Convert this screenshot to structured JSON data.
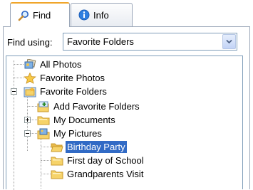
{
  "tabs": [
    {
      "label": "Find",
      "icon": "magnifier-icon",
      "active": true
    },
    {
      "label": "Info",
      "icon": "info-icon",
      "active": false
    }
  ],
  "find": {
    "label": "Find using:",
    "selected": "Favorite Folders"
  },
  "tree": {
    "items": [
      {
        "label": "All Photos",
        "icon": "photos-stack-icon"
      },
      {
        "label": "Favorite Photos",
        "icon": "star-icon"
      },
      {
        "label": "Favorite Folders",
        "icon": "favorite-folder-icon"
      },
      {
        "label": "Add Favorite Folders",
        "icon": "add-folder-icon"
      },
      {
        "label": "My Documents",
        "icon": "folder-icon"
      },
      {
        "label": "My Pictures",
        "icon": "pictures-folder-icon"
      },
      {
        "label": "Birthday Party",
        "icon": "open-folder-icon",
        "selected": true
      },
      {
        "label": "First day of School",
        "icon": "folder-icon"
      },
      {
        "label": "Grandparents Visit",
        "icon": "folder-icon"
      }
    ]
  },
  "colors": {
    "selection": "#316ac5",
    "tab_highlight": "#f0a52a",
    "folder": "#f6d36a"
  }
}
